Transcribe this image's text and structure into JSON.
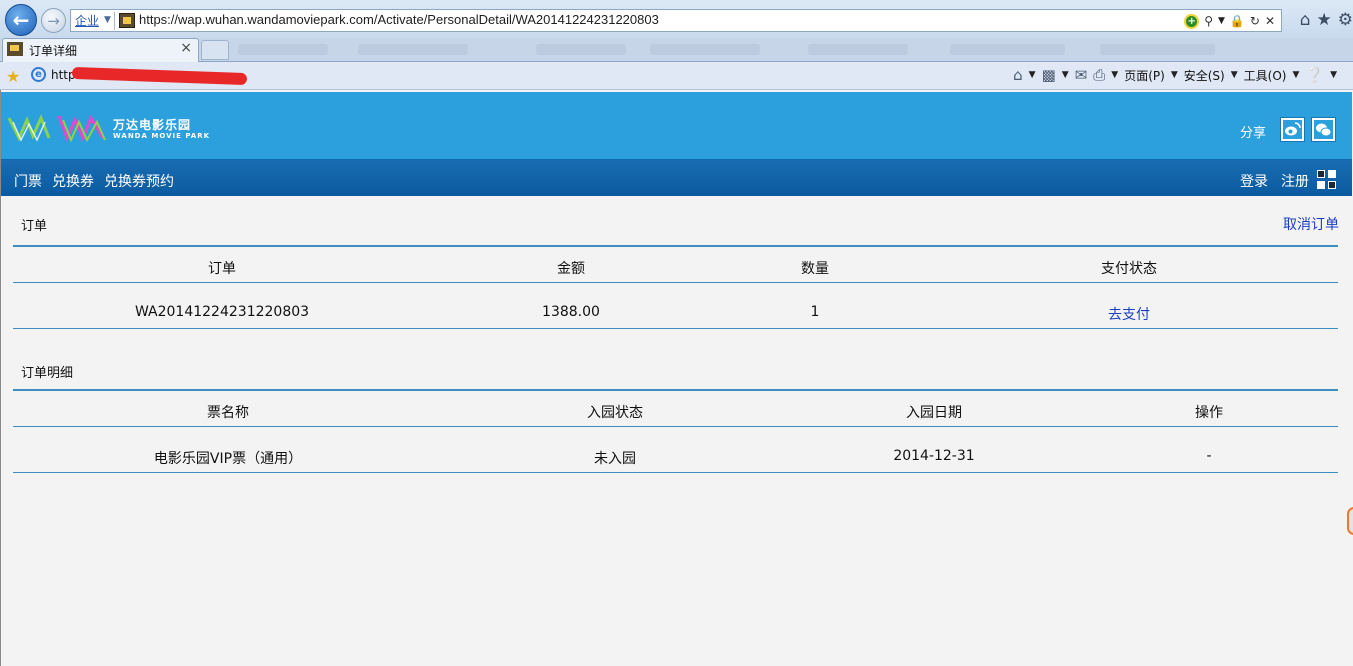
{
  "browser": {
    "zone_label": "企业",
    "url": "https://wap.wuhan.wandamoviepark.com/Activate/PersonalDetail/WA20141224231220803",
    "tab_title": "订单详细",
    "favorites_link": "http",
    "menu": {
      "page": "页面(P)",
      "safety": "安全(S)",
      "tools": "工具(O)"
    }
  },
  "site": {
    "logo_cn": "万达电影乐园",
    "logo_en": "WANDA MOVIE PARK",
    "share_label": "分享",
    "nav": {
      "tickets": "门票",
      "vouchers": "兑换券",
      "voucher_booking": "兑换券预约",
      "login": "登录",
      "register": "注册"
    }
  },
  "order": {
    "section_title": "订单",
    "cancel_label": "取消订单",
    "headers": [
      "订单",
      "金额",
      "数量",
      "支付状态"
    ],
    "row": {
      "order_no": "WA20141224231220803",
      "amount": "1388.00",
      "quantity": "1",
      "pay_action": "去支付"
    }
  },
  "details": {
    "section_title": "订单明细",
    "headers": [
      "票名称",
      "入园状态",
      "入园日期",
      "操作"
    ],
    "row": {
      "ticket_name": "电影乐园VIP票（通用）",
      "entry_status": "未入园",
      "entry_date": "2014-12-31",
      "action": "-"
    }
  },
  "colors": {
    "header_blue": "#2c9fdd",
    "nav_blue": "#0a5aa0",
    "link_blue": "#1a3fc4",
    "rule_blue": "#3e8ec0"
  }
}
